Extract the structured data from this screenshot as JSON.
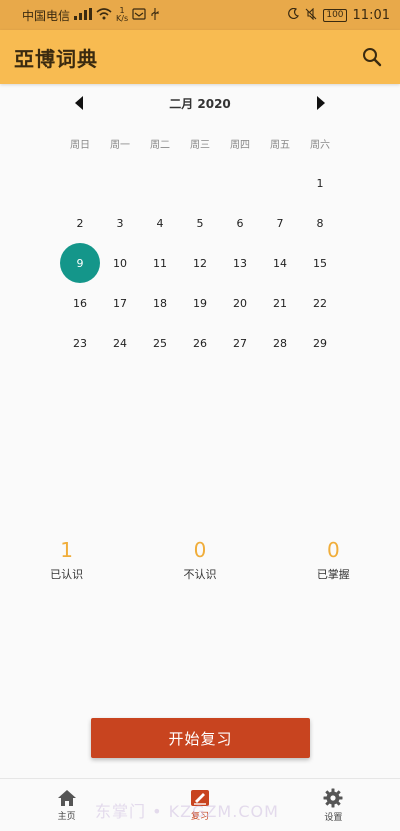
{
  "status_bar": {
    "carrier": "中国电信",
    "speed_top": "1",
    "speed_bottom": "K/s",
    "battery": "100",
    "time": "11:01"
  },
  "app_bar": {
    "title": "亞博词典"
  },
  "calendar": {
    "month_title": "二月 2020",
    "weekdays": [
      "周日",
      "周一",
      "周二",
      "周三",
      "周四",
      "周五",
      "周六"
    ],
    "days": [
      "",
      "",
      "",
      "",
      "",
      "",
      "1",
      "2",
      "3",
      "4",
      "5",
      "6",
      "7",
      "8",
      "9",
      "10",
      "11",
      "12",
      "13",
      "14",
      "15",
      "16",
      "17",
      "18",
      "19",
      "20",
      "21",
      "22",
      "23",
      "24",
      "25",
      "26",
      "27",
      "28",
      "29"
    ],
    "selected_day": "9"
  },
  "stats": [
    {
      "value": "1",
      "label": "已认识"
    },
    {
      "value": "0",
      "label": "不认识"
    },
    {
      "value": "0",
      "label": "已掌握"
    }
  ],
  "review_button": "开始复习",
  "bottom_nav": [
    {
      "label": "主页",
      "icon": "home-icon"
    },
    {
      "label": "复习",
      "icon": "review-icon"
    },
    {
      "label": "设置",
      "icon": "gear-icon"
    }
  ],
  "watermark": "东掌门 • KZ​GZM.COM",
  "colors": {
    "accent": "#f8bb51",
    "selected": "#14968a",
    "button": "#c8441f",
    "stat": "#f0ad3a"
  }
}
